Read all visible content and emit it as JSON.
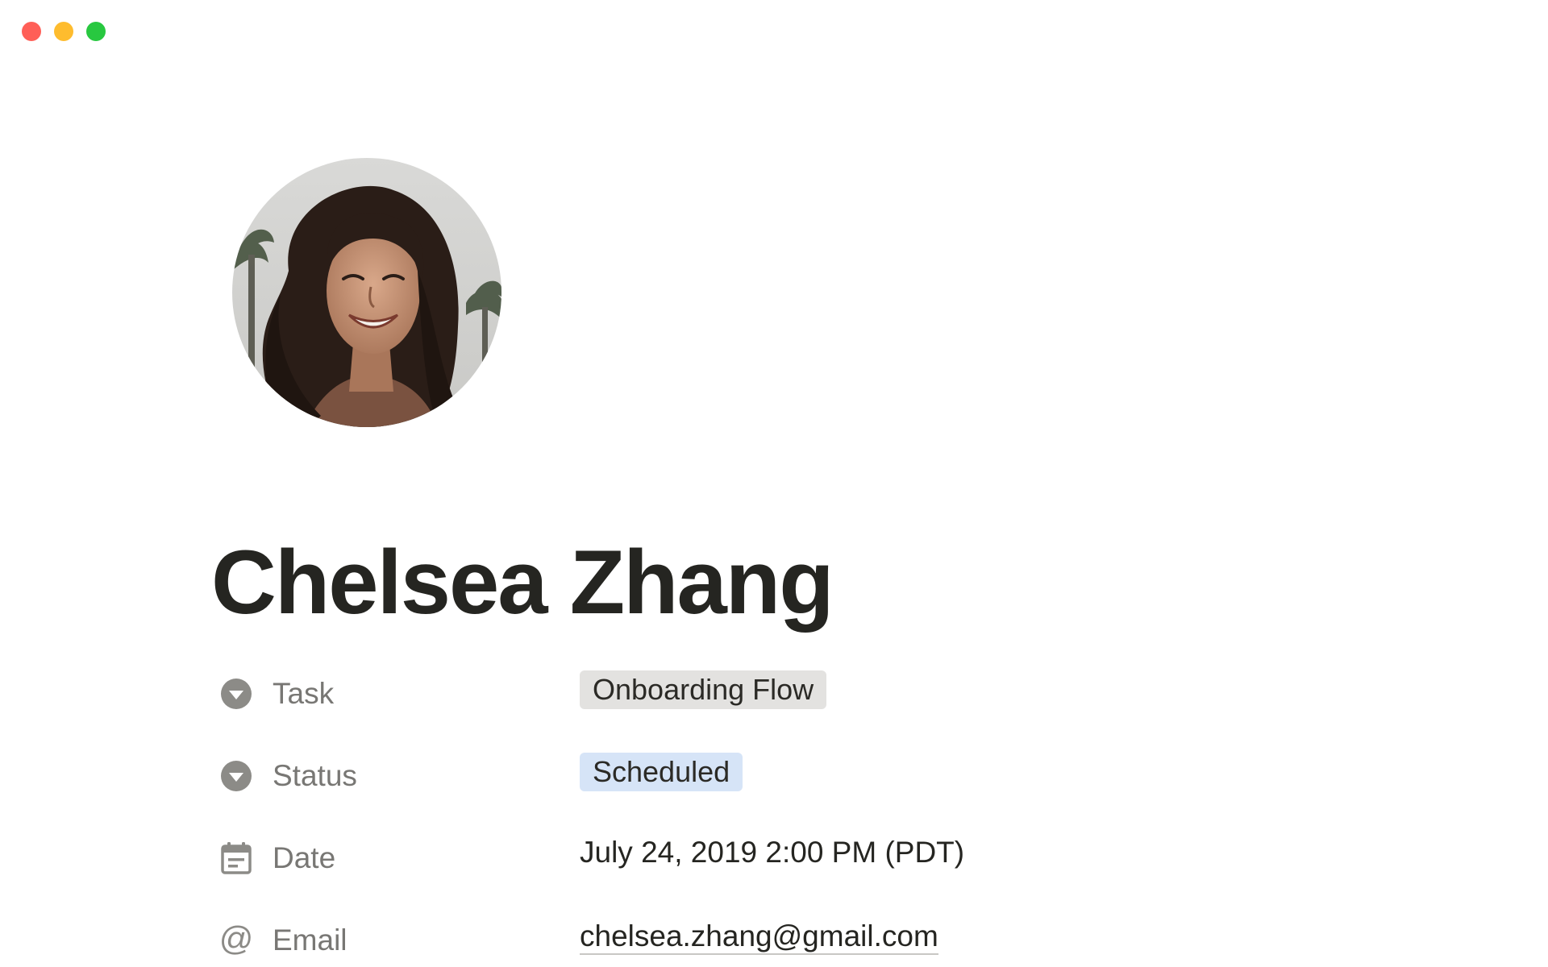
{
  "window": {
    "controls": [
      "close",
      "minimize",
      "zoom"
    ]
  },
  "avatar": {
    "icon": "profile-photo"
  },
  "page": {
    "title": "Chelsea Zhang"
  },
  "properties": [
    {
      "icon": "select-icon",
      "name": "Task",
      "value": "Onboarding Flow",
      "tag_color": "#e3e2e0"
    },
    {
      "icon": "select-icon",
      "name": "Status",
      "value": "Scheduled",
      "tag_color": "#d6e4f7"
    },
    {
      "icon": "calendar-icon",
      "name": "Date",
      "value": "July 24, 2019 2:00 PM (PDT)"
    },
    {
      "icon": "at-icon",
      "name": "Email",
      "value": "chelsea.zhang@gmail.com"
    }
  ],
  "colors": {
    "text": "#252521",
    "label": "#787774",
    "tag_gray": "#e3e2e0",
    "tag_blue": "#d6e4f7"
  }
}
